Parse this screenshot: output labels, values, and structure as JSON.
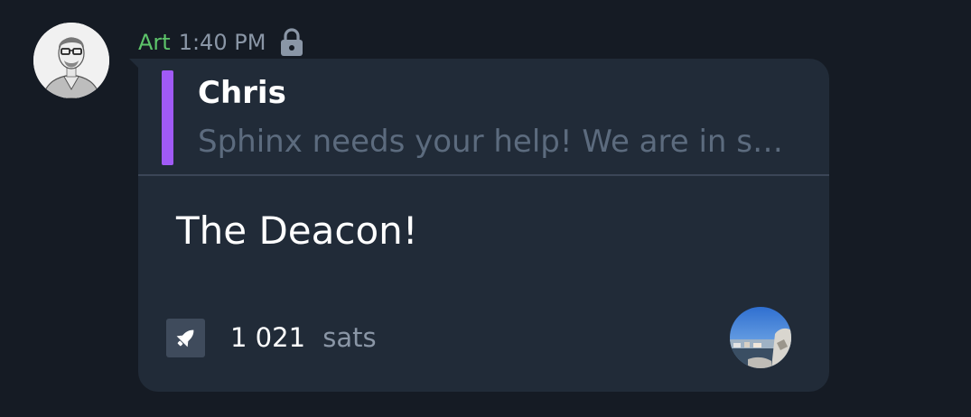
{
  "message": {
    "sender": "Art",
    "time": "1:40 PM",
    "sender_color": "#5dc46a",
    "lock_icon": "lock-icon",
    "avatar_icon": "user-avatar-sketch",
    "reply": {
      "name": "Chris",
      "text": "Sphinx needs your help! We are in s…",
      "bar_color": "#a05af6"
    },
    "body": "The Deacon!",
    "boost": {
      "icon": "boost-rocket-icon",
      "amount": "1 021",
      "unit": "sats",
      "booster_avatar": "booster-avatar-photo"
    }
  }
}
